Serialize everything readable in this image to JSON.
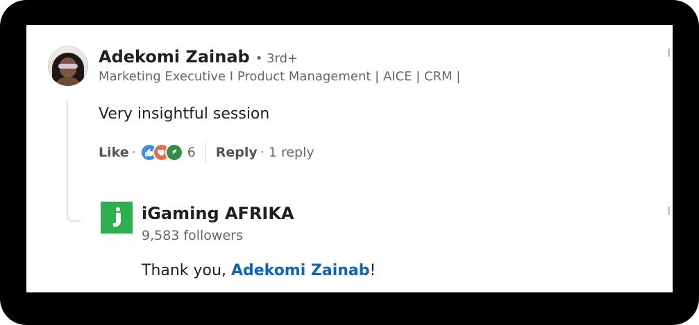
{
  "comment": {
    "author_name": "Adekomi Zainab",
    "degree": "• 3rd+",
    "headline": "Marketing Executive I Product Management | AICE | CRM |",
    "text": "Very insightful session",
    "actions": {
      "like_label": "Like",
      "like_separator": "·",
      "reaction_count": "6",
      "reply_label": "Reply",
      "reply_separator": "·",
      "reply_count": "1 reply"
    },
    "reactions": [
      "like-icon",
      "love-icon",
      "support-icon"
    ]
  },
  "reply": {
    "author_name": "iGaming AFRIKA",
    "followers": "9,583 followers",
    "text_prefix": "Thank you, ",
    "mention": "Adekomi Zainab",
    "text_suffix": "!"
  },
  "colors": {
    "frame": "#000000",
    "card": "#ffffff",
    "mention": "#0a66c2",
    "like_reaction": "#378fe9",
    "love_reaction": "#df704d",
    "support_reaction": "#2f8f46",
    "company_logo": "#2fb04f"
  }
}
